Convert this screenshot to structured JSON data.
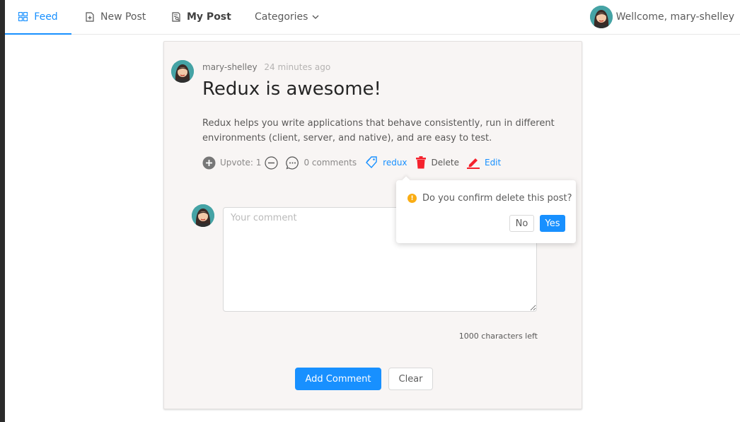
{
  "nav": {
    "feed": "Feed",
    "new_post": "New Post",
    "my_post": "My Post",
    "categories": "Categories",
    "welcome": "Wellcome, mary-shelley"
  },
  "post": {
    "author": "mary-shelley",
    "time": "24 minutes ago",
    "title": "Redux is awesome!",
    "body": "Redux helps you write applications that behave consistently, run in different environments (client, server, and native), and are easy to test.",
    "upvote_label": "Upvote: 1",
    "comments_label": "0 comments",
    "tag": "redux",
    "delete_label": "Delete",
    "edit_label": "Edit"
  },
  "comment_form": {
    "placeholder": "Your comment",
    "chars_left": "1000 characters left",
    "add_button": "Add Comment",
    "clear_button": "Clear"
  },
  "popconfirm": {
    "message": "Do you confirm delete this post?",
    "no": "No",
    "yes": "Yes"
  },
  "colors": {
    "accent": "#1890ff",
    "danger": "#f5222d",
    "warning": "#faad14",
    "card_bg": "#f8f5f4"
  }
}
